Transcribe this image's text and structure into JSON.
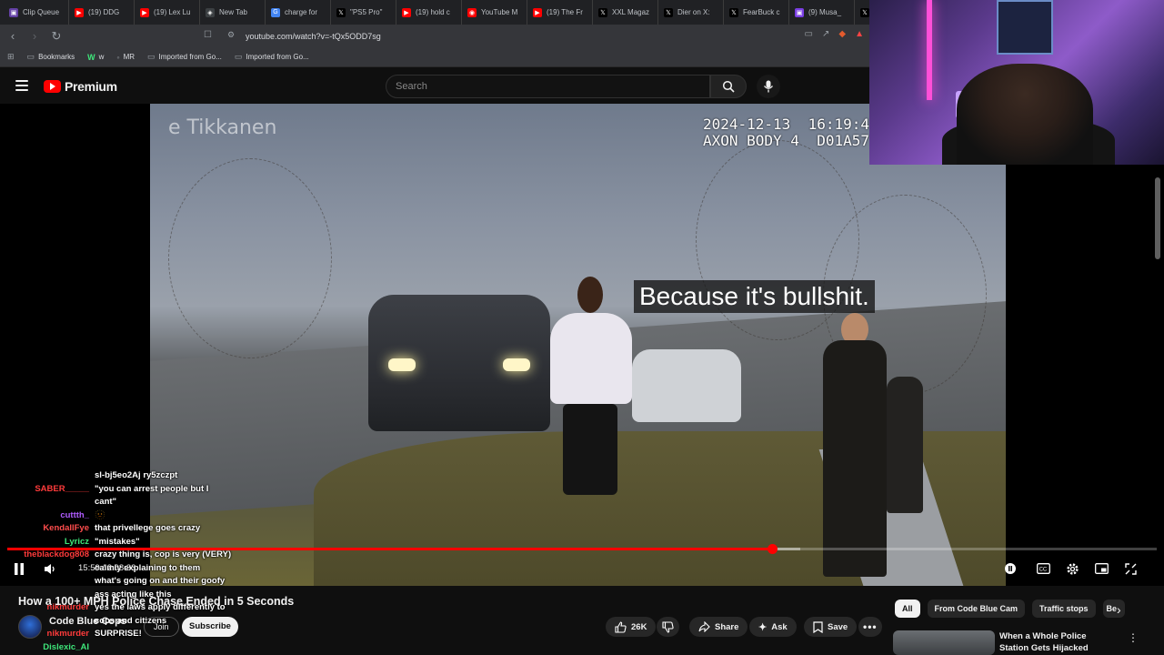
{
  "tabs": [
    {
      "label": "Clip Queue",
      "color": "#6441a5",
      "glyph": "▣"
    },
    {
      "label": "(19) DDG",
      "color": "#ff0000",
      "glyph": "▶"
    },
    {
      "label": "(19) Lex Lu",
      "color": "#ff0000",
      "glyph": "▶"
    },
    {
      "label": "New Tab",
      "color": "#3c4043",
      "glyph": "◈"
    },
    {
      "label": "charge for",
      "color": "#4285f4",
      "glyph": "G"
    },
    {
      "label": "\"PS5 Pro\"",
      "color": "#000000",
      "glyph": "𝕏"
    },
    {
      "label": "(19) hold c",
      "color": "#ff0000",
      "glyph": "▶"
    },
    {
      "label": "YouTube M",
      "color": "#ff0000",
      "glyph": "◉"
    },
    {
      "label": "(19) The Fr",
      "color": "#ff0000",
      "glyph": "▶"
    },
    {
      "label": "XXL Magaz",
      "color": "#000000",
      "glyph": "𝕏"
    },
    {
      "label": "Dier on X:",
      "color": "#000000",
      "glyph": "𝕏"
    },
    {
      "label": "FearBuck c",
      "color": "#000000",
      "glyph": "𝕏"
    },
    {
      "label": "(9) Musa_",
      "color": "#7b3fe4",
      "glyph": "▣"
    },
    {
      "label": "S",
      "color": "#000000",
      "glyph": "𝕏"
    }
  ],
  "address": {
    "url": "youtube.com/watch?v=-tQx5ODD7sg"
  },
  "bookmarks": [
    {
      "label": "Bookmarks",
      "icon": "folder-icon"
    },
    {
      "label": "w",
      "icon": "w-icon"
    },
    {
      "label": "MR",
      "icon": "mr-icon"
    },
    {
      "label": "Imported from Go...",
      "icon": "folder-icon"
    },
    {
      "label": "Imported from Go...",
      "icon": "folder-icon"
    }
  ],
  "youtube": {
    "logo_text": "Premium",
    "search_placeholder": "Search"
  },
  "video": {
    "watermark": "e Tikkanen",
    "timestamp_line1": "2024-12-13  16:19:4",
    "timestamp_line2": "AXON BODY 4  D01A57",
    "caption": "Because it's bullshit.",
    "time_display": "15:59 / 2:08:33",
    "progress_fraction": 0.665,
    "buffered_fraction": 0.69
  },
  "chat": [
    {
      "user": "",
      "user_color": "#ffffff",
      "message": "sl-bj5eo2Aj ry5zczpt"
    },
    {
      "user": "SABER_____",
      "user_color": "#ff3b3b",
      "message": "\"you can arrest people but I"
    },
    {
      "user": "",
      "user_color": "#ffffff",
      "message": "cant\""
    },
    {
      "user": "cuttth_",
      "user_color": "#b05cff",
      "message": "🫥"
    },
    {
      "user": "KendallFye",
      "user_color": "#ff4d4d",
      "message": "that privellege goes crazy"
    },
    {
      "user": "Lyricz",
      "user_color": "#3ee67a",
      "message": "\"mistakes\""
    },
    {
      "user": "theblackdog808",
      "user_color": "#ff3b3b",
      "message": "crazy thing is, cop is very (VERY)"
    },
    {
      "user": "",
      "user_color": "#ffffff",
      "message": "calmly explaining to them"
    },
    {
      "user": "",
      "user_color": "#ffffff",
      "message": "what's going on and their goofy"
    },
    {
      "user": "",
      "user_color": "#ffffff",
      "message": "ass acting like this"
    },
    {
      "user": "nikmurder",
      "user_color": "#ff3b3b",
      "message": "yes the laws apply differently to"
    },
    {
      "user": "",
      "user_color": "#ffffff",
      "message": "cops and citizens"
    },
    {
      "user": "nikmurder",
      "user_color": "#ff3b3b",
      "message": "SURPRISE!"
    },
    {
      "user": "Dislexic_AI",
      "user_color": "#3ee67a",
      "message": ""
    }
  ],
  "below": {
    "title": "How a 100+ MPH Police Chase Ended in 5 Seconds",
    "channel": "Code Blue Cops",
    "join": "Join",
    "subscribe": "Subscribe",
    "likes": "26K",
    "share": "Share",
    "ask": "Ask",
    "save": "Save"
  },
  "chips": [
    "All",
    "From Code Blue Cam",
    "Traffic stops",
    "Be"
  ],
  "recommendation": {
    "title": "When a Whole Police Station Gets Hijacked"
  },
  "colors": {
    "accent_red": "#ff0000",
    "background": "#0f0f0f"
  }
}
